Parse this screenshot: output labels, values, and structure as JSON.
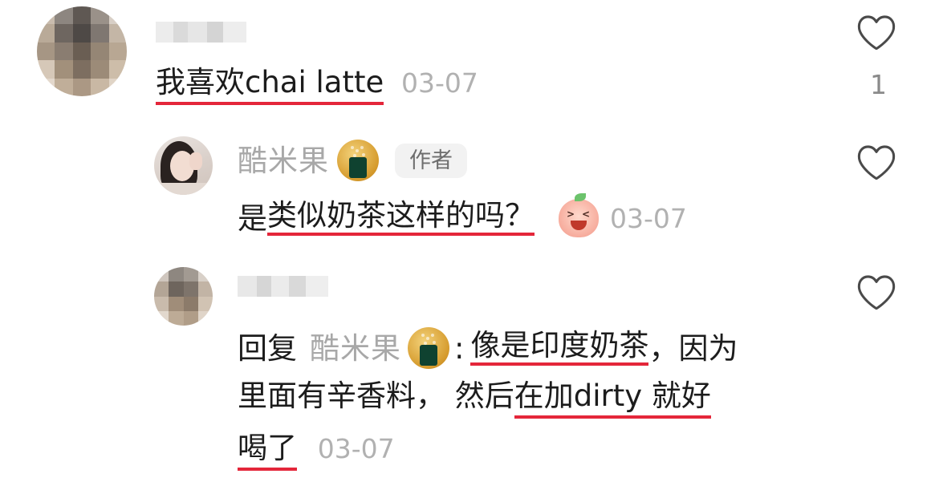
{
  "comments": [
    {
      "text": "我喜欢chai latte",
      "date": "03-07",
      "like_count": "1"
    },
    {
      "username": "酷米果",
      "author_badge": "作者",
      "text_prefix": "是",
      "text_underlined": "类似奶茶这样的吗？",
      "date": "03-07"
    },
    {
      "reply_label": "回复",
      "reply_to": "酷米果",
      "colon": ":",
      "line1_underlined": "像是印度奶茶",
      "line1_rest": "，因为",
      "line2_start": "里面有辛香料， 然后",
      "line2_underlined": "在加dirty 就好",
      "line3_underlined": "喝了",
      "date": "03-07"
    }
  ],
  "icons": {
    "like": "heart-outline-icon",
    "author_emoji": "rice-ball-emoji-icon",
    "laugh_emoji": "laughing-peach-emoji-icon"
  },
  "colors": {
    "underline": "#e4263a",
    "meta_gray": "#b1b1b1"
  }
}
